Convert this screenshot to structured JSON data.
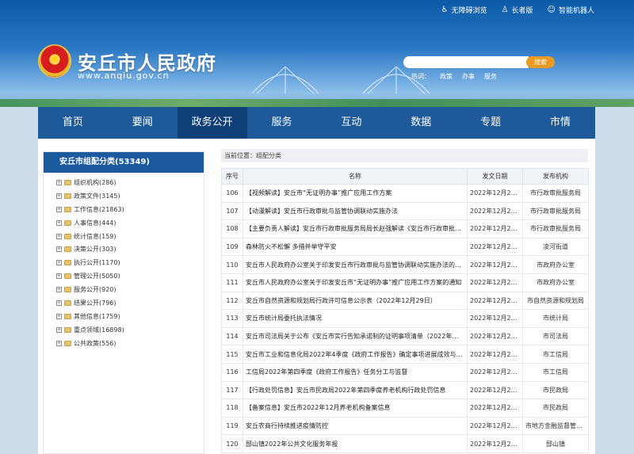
{
  "topbar": [
    {
      "icon": "accessibility-icon",
      "glyph": "♿",
      "label": "无障碍浏览"
    },
    {
      "icon": "elderly-icon",
      "glyph": "♙",
      "label": "长者版"
    },
    {
      "icon": "robot-icon",
      "glyph": "☺",
      "label": "智能机器人"
    }
  ],
  "site": {
    "title": "安丘市人民政府",
    "url": "www.anqiu.gov.cn"
  },
  "search": {
    "placeholder": "",
    "button": "搜索"
  },
  "hot": {
    "label": "热词：",
    "words": [
      "政策",
      "办事",
      "服务"
    ]
  },
  "nav": [
    {
      "label": "首页",
      "active": false
    },
    {
      "label": "要闻",
      "active": false
    },
    {
      "label": "政务公开",
      "active": true
    },
    {
      "label": "服务",
      "active": false
    },
    {
      "label": "互动",
      "active": false
    },
    {
      "label": "数据",
      "active": false
    },
    {
      "label": "专题",
      "active": false
    },
    {
      "label": "市情",
      "active": false
    }
  ],
  "sidebar": {
    "title": "安丘市组配分类(53349)",
    "items": [
      "组织机构(286)",
      "政策文件(3145)",
      "工作信息(21863)",
      "人事信息(444)",
      "统计信息(159)",
      "决策公开(303)",
      "执行公开(1170)",
      "管理公开(5050)",
      "服务公开(920)",
      "结果公开(796)",
      "其他信息(1759)",
      "重点领域(16898)",
      "公共政策(556)"
    ]
  },
  "breadcrumb": "当前位置：组配分类",
  "table": {
    "headers": [
      "序号",
      "名称",
      "发文日期",
      "发布机构"
    ],
    "rows": [
      [
        "106",
        "【视频解读】安丘市“无证明办事”推广应用工作方案",
        "2022年12月29日",
        "市行政审批服务局"
      ],
      [
        "107",
        "【动漫解读】安丘市行政审批与监管协调联动实施办法",
        "2022年12月29日",
        "市行政审批服务局"
      ],
      [
        "108",
        "【主要负责人解读】安丘市行政审批服务局局长赵强解读《安丘市行政审批与监...",
        "2022年12月29日",
        "市行政审批服务局"
      ],
      [
        "109",
        "森林防火不松懈 多措并举守平安",
        "2022年12月29日",
        "凌河街道"
      ],
      [
        "110",
        "安丘市人民政府办公室关于印发安丘市行政审批与监管协调联动实施办法的通知",
        "2022年12月29日",
        "市政府办公室"
      ],
      [
        "111",
        "安丘市人民政府办公室关于印发安丘市“无证明办事”推广应用工作方案的通知",
        "2022年12月29日",
        "市政府办公室"
      ],
      [
        "112",
        "安丘市自然资源和规划局行政许可信息公示表（2022年12月29日）",
        "2022年12月29日",
        "市自然资源和规划局"
      ],
      [
        "113",
        "安丘市统计局委托执法情况",
        "2022年12月29日",
        "市统计局"
      ],
      [
        "114",
        "安丘市司法局关于公布《安丘市实行告知承诺制的证明事项清单（2022年版）》...",
        "2022年12月29日",
        "市司法局"
      ],
      [
        "115",
        "安丘市工业和信息化局2022年4季度《政府工作报告》确定事项进展成效与举措",
        "2022年12月29日",
        "市工信局"
      ],
      [
        "116",
        "工信局2022年第四季度《政府工作报告》任务分工与监督",
        "2022年12月29日",
        "市工信局"
      ],
      [
        "117",
        "【行政处罚信息】安丘市民政局2022年第四季度养老机构行政处罚信息",
        "2022年12月29日",
        "市民政局"
      ],
      [
        "118",
        "【备案信息】安丘市2022年12月养老机构备案信息",
        "2022年12月29日",
        "市民政局"
      ],
      [
        "119",
        "安丘农商行持续推进疫情防控",
        "2022年12月29日",
        "市地方金融监督管理局"
      ],
      [
        "120",
        "郚山镇2022年公共文化服务年报",
        "2022年12月28日",
        "郚山镇"
      ]
    ]
  }
}
